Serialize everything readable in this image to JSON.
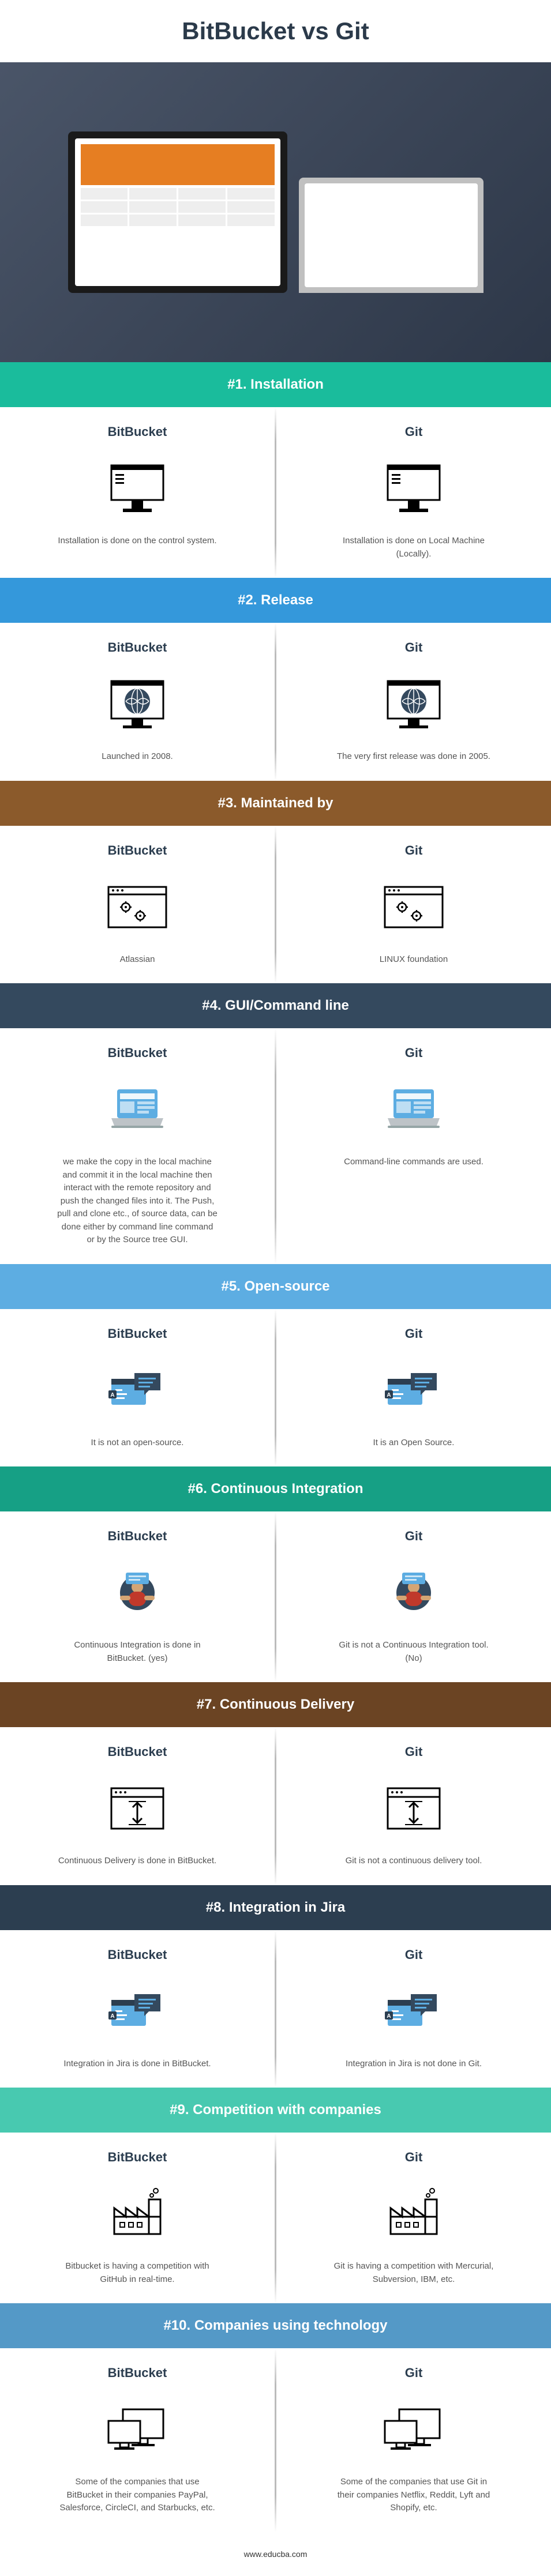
{
  "title": "BitBucket vs Git",
  "footer": "www.educba.com",
  "sections": [
    {
      "header": "#1. Installation",
      "bg": "bg-green",
      "left": {
        "label": "BitBucket",
        "text": "Installation is done on the control system.",
        "icon": "desktop-icon"
      },
      "right": {
        "label": "Git",
        "text": "Installation is done on Local Machine (Locally).",
        "icon": "desktop-icon"
      }
    },
    {
      "header": "#2. Release",
      "bg": "bg-blue",
      "left": {
        "label": "BitBucket",
        "text": "Launched in 2008.",
        "icon": "globe-icon"
      },
      "right": {
        "label": "Git",
        "text": "The very first release was done in 2005.",
        "icon": "globe-icon"
      }
    },
    {
      "header": "#3. Maintained by",
      "bg": "bg-brown",
      "left": {
        "label": "BitBucket",
        "text": "Atlassian",
        "icon": "settings-window-icon"
      },
      "right": {
        "label": "Git",
        "text": "LINUX foundation",
        "icon": "settings-window-icon"
      }
    },
    {
      "header": "#4. GUI/Command line",
      "bg": "bg-dark",
      "left": {
        "label": "BitBucket",
        "text": "we make the copy in the local machine and commit it in the local machine then interact with the remote repository and push the changed files into it. The Push, pull and clone etc., of source data, can be done either by command line command or by the Source tree GUI.",
        "icon": "laptop-icon"
      },
      "right": {
        "label": "Git",
        "text": "Command-line commands are used.",
        "icon": "laptop-icon"
      }
    },
    {
      "header": "#5. Open-source",
      "bg": "bg-lightblue",
      "left": {
        "label": "BitBucket",
        "text": "It is not an open-source.",
        "icon": "chat-code-icon"
      },
      "right": {
        "label": "Git",
        "text": "It is an Open Source.",
        "icon": "chat-code-icon"
      }
    },
    {
      "header": "#6. Continuous Integration",
      "bg": "bg-teal",
      "left": {
        "label": "BitBucket",
        "text": "Continuous Integration is done in BitBucket. (yes)",
        "icon": "person-top-icon"
      },
      "right": {
        "label": "Git",
        "text": "Git is not a Continuous Integration tool. (No)",
        "icon": "person-top-icon"
      }
    },
    {
      "header": "#7. Continuous Delivery",
      "bg": "bg-darkbrown",
      "left": {
        "label": "BitBucket",
        "text": "Continuous Delivery is done in BitBucket.",
        "icon": "transfer-window-icon"
      },
      "right": {
        "label": "Git",
        "text": "Git is not a continuous delivery tool.",
        "icon": "transfer-window-icon"
      }
    },
    {
      "header": "#8. Integration in Jira",
      "bg": "bg-navy",
      "left": {
        "label": "BitBucket",
        "text": "Integration in Jira is done in BitBucket.",
        "icon": "chat-code-icon"
      },
      "right": {
        "label": "Git",
        "text": "Integration in Jira is not done in Git.",
        "icon": "chat-code-icon"
      }
    },
    {
      "header": "#9. Competition with companies",
      "bg": "bg-mint",
      "left": {
        "label": "BitBucket",
        "text": "Bitbucket is having a competition with GitHub in real-time.",
        "icon": "factory-icon"
      },
      "right": {
        "label": "Git",
        "text": "Git is having a competition with Mercurial, Subversion, IBM, etc.",
        "icon": "factory-icon"
      }
    },
    {
      "header": "#10. Companies using technology",
      "bg": "bg-skyblue",
      "left": {
        "label": "BitBucket",
        "text": "Some of the companies that use BitBucket in their companies PayPal, Salesforce, CircleCI, and Starbucks, etc.",
        "icon": "monitors-icon"
      },
      "right": {
        "label": "Git",
        "text": "Some of the companies that use Git in their companies Netflix, Reddit, Lyft and Shopify, etc.",
        "icon": "monitors-icon"
      }
    }
  ],
  "icons": {
    "desktop-icon": "desktop",
    "globe-icon": "globe",
    "settings-window-icon": "settings-window",
    "laptop-icon": "laptop",
    "chat-code-icon": "chat-code",
    "person-top-icon": "person-top",
    "transfer-window-icon": "transfer-window",
    "factory-icon": "factory",
    "monitors-icon": "monitors"
  }
}
